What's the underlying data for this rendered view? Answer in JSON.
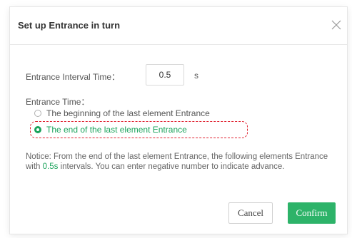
{
  "dialog": {
    "title": "Set up Entrance in turn",
    "close_icon": "close-icon"
  },
  "interval": {
    "label": "Entrance Interval Time：",
    "value": "0.5",
    "unit": "s"
  },
  "entrance_time": {
    "label": "Entrance Time：",
    "options": [
      {
        "label": "The beginning of the last element Entrance",
        "selected": false
      },
      {
        "label": "The end of the last element Entrance",
        "selected": true
      }
    ]
  },
  "notice": {
    "prefix": "Notice: From the end of the last element Entrance, the following elements Entrance with ",
    "interval_value": "0.5s",
    "suffix": " intervals. You can enter negative number to indicate advance."
  },
  "buttons": {
    "cancel": "Cancel",
    "confirm": "Confirm"
  },
  "colors": {
    "accent": "#1aa35b",
    "confirm_bg": "#2db369",
    "highlight": "#e0212f"
  }
}
